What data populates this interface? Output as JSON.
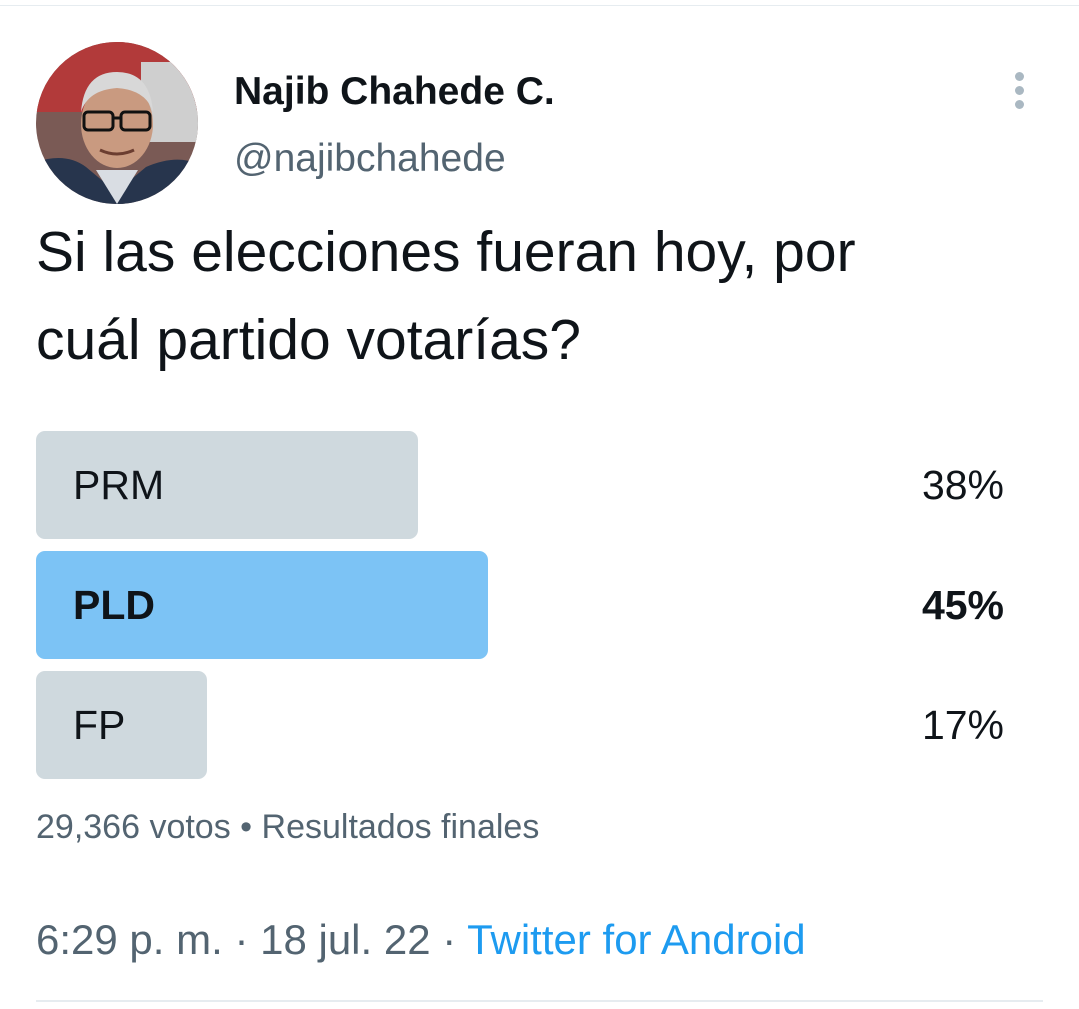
{
  "author": {
    "name": "Najib Chahede C.",
    "handle": "@najibchahede"
  },
  "tweet": {
    "text_line1": "Si las elecciones fueran hoy, por",
    "text_line2": "cuál partido votarías?"
  },
  "poll": {
    "options": [
      {
        "label": "PRM",
        "percent": "38%",
        "value": 38,
        "winner": false
      },
      {
        "label": "PLD",
        "percent": "45%",
        "value": 45,
        "winner": true
      },
      {
        "label": "FP",
        "percent": "17%",
        "value": 17,
        "winner": false
      }
    ],
    "votes": "29,366 votos",
    "separator": "•",
    "status": "Resultados finales"
  },
  "meta": {
    "time": "6:29 p. m.",
    "sep": "·",
    "date": "18 jul. 22",
    "source": "Twitter for Android"
  },
  "colors": {
    "winner_bar": "#7cc3f5",
    "bar": "#cfd9de",
    "link": "#1d9bf0",
    "secondary_text": "#536471"
  },
  "icons": {
    "more": "more-vertical-icon"
  }
}
